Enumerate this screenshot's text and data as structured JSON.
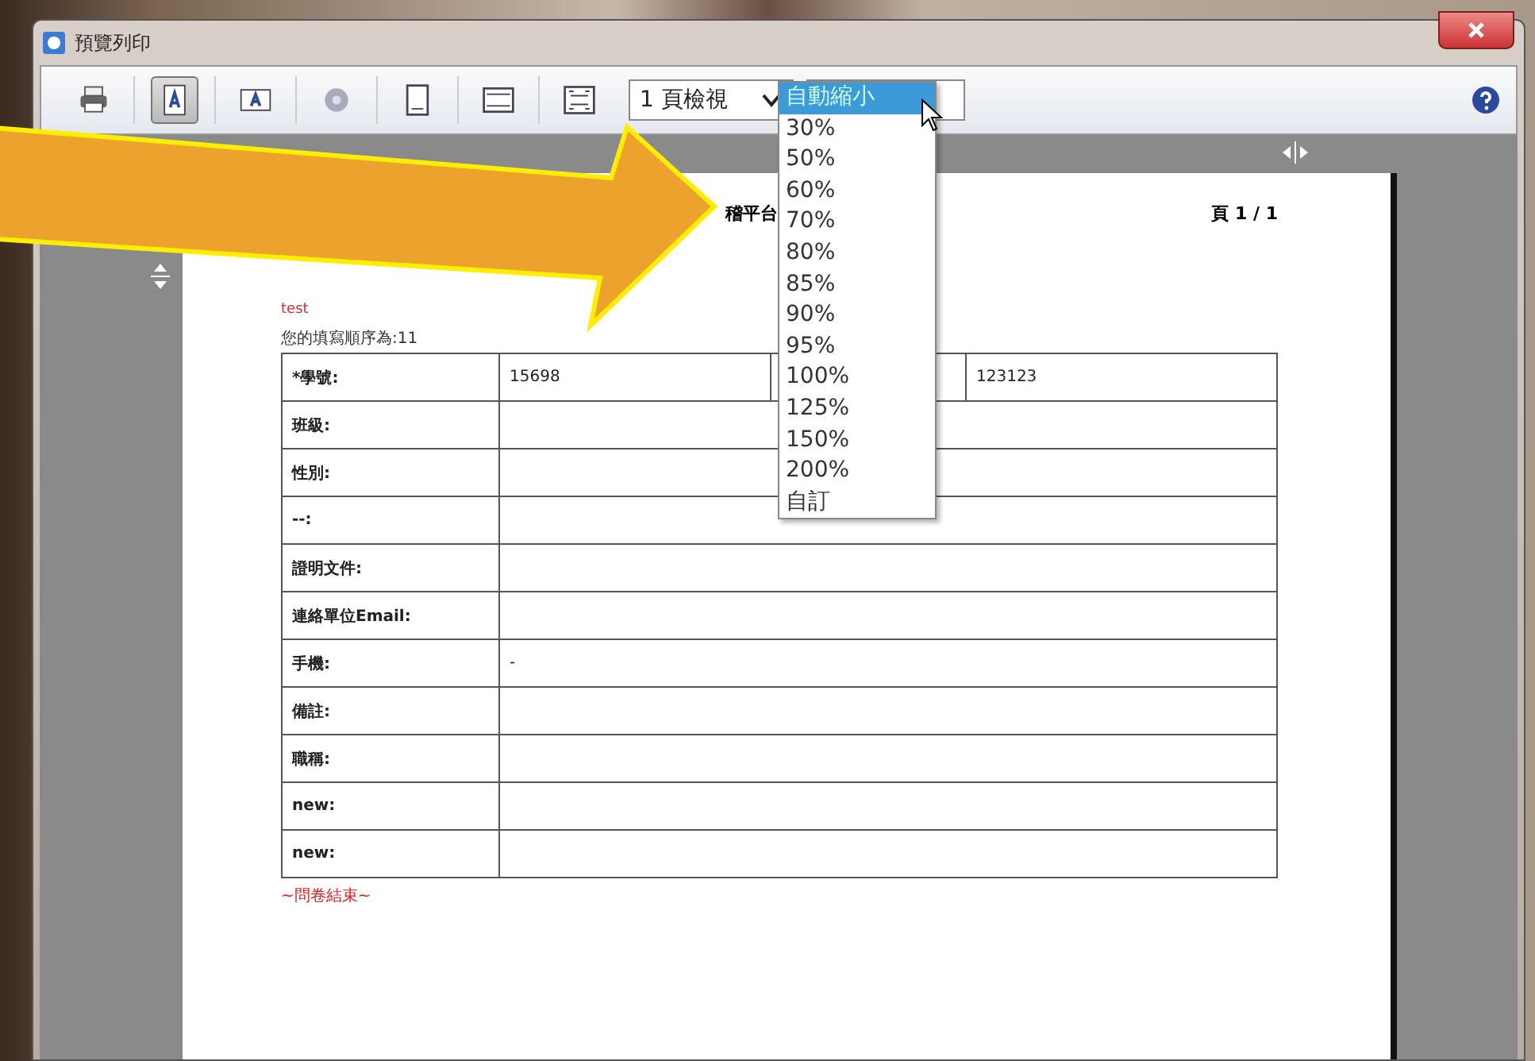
{
  "window": {
    "title": "預覽列印"
  },
  "toolbar_buttons": [
    {
      "kind": "print",
      "selected": false
    },
    {
      "kind": "portrait",
      "selected": true
    },
    {
      "kind": "landscape",
      "selected": false
    },
    {
      "kind": "gear",
      "selected": false
    },
    {
      "kind": "page",
      "selected": false
    },
    {
      "kind": "header",
      "selected": false
    },
    {
      "kind": "fullpage",
      "selected": false
    }
  ],
  "view_select": {
    "value": "1 頁檢視"
  },
  "zoom_dropdown": {
    "options": [
      {
        "label": "自動縮小",
        "selected": true
      },
      {
        "label": "30%",
        "selected": false
      },
      {
        "label": "50%",
        "selected": false
      },
      {
        "label": "60%",
        "selected": false
      },
      {
        "label": "70%",
        "selected": false
      },
      {
        "label": "80%",
        "selected": false
      },
      {
        "label": "85%",
        "selected": false
      },
      {
        "label": "90%",
        "selected": false
      },
      {
        "label": "95%",
        "selected": false
      },
      {
        "label": "100%",
        "selected": false
      },
      {
        "label": "125%",
        "selected": false
      },
      {
        "label": "150%",
        "selected": false
      },
      {
        "label": "200%",
        "selected": false
      },
      {
        "label": "自訂",
        "selected": false
      }
    ]
  },
  "page": {
    "header": "稽平台",
    "page_number": "頁 1 / 1",
    "title": "test",
    "order_note": "您的填寫順序為:11",
    "rows": [
      {
        "kind": "split",
        "label": "*學號:",
        "value": "15698",
        "extra": "123123"
      },
      {
        "kind": "plain",
        "label": "班級:"
      },
      {
        "kind": "plain",
        "label": "性別:"
      },
      {
        "kind": "plain",
        "label": "--:"
      },
      {
        "kind": "plain",
        "label": "證明文件:"
      },
      {
        "kind": "plain",
        "label": "連絡單位Email:"
      },
      {
        "kind": "plain",
        "label": "手機:",
        "value": "-"
      },
      {
        "kind": "plain",
        "label": "備註:"
      },
      {
        "kind": "plain",
        "label": "職稱:"
      },
      {
        "kind": "plain",
        "label": "new:"
      },
      {
        "kind": "plain",
        "label": "new:"
      }
    ],
    "footer": "~問卷結束~"
  }
}
